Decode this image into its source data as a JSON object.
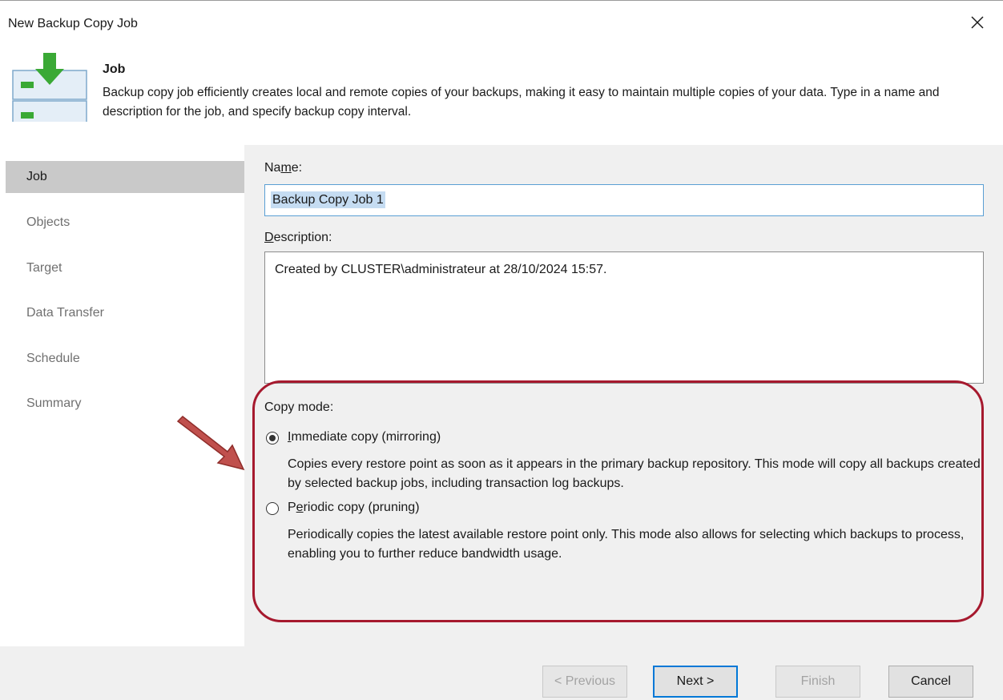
{
  "window": {
    "title": "New Backup Copy Job"
  },
  "header": {
    "title": "Job",
    "description": "Backup copy job efficiently creates local and remote copies of your backups, making it easy to maintain multiple copies of your data. Type in a name and description for the job, and specify backup copy interval."
  },
  "nav": {
    "items": [
      {
        "label": "Job",
        "active": true
      },
      {
        "label": "Objects",
        "active": false
      },
      {
        "label": "Target",
        "active": false
      },
      {
        "label": "Data Transfer",
        "active": false
      },
      {
        "label": "Schedule",
        "active": false
      },
      {
        "label": "Summary",
        "active": false
      }
    ]
  },
  "form": {
    "name_label": "Name:",
    "name_value": "Backup Copy Job 1",
    "description_label": "Description:",
    "description_value": "Created by CLUSTER\\administrateur at 28/10/2024 15:57.",
    "copy_mode_label": "Copy mode:",
    "options": [
      {
        "label": "Immediate copy (mirroring)",
        "selected": true,
        "description": "Copies every restore point as soon as it appears in the primary backup repository. This mode will copy all backups created by selected backup jobs, including transaction log backups."
      },
      {
        "label": "Periodic copy (pruning)",
        "selected": false,
        "description": "Periodically copies the latest available restore point only. This mode also allows for selecting which backups to process, enabling you to further reduce bandwidth usage."
      }
    ]
  },
  "footer": {
    "previous_label": "< Previous",
    "next_label": "Next >",
    "finish_label": "Finish",
    "cancel_label": "Cancel"
  },
  "colors": {
    "highlight": "#a6192e",
    "arrow": "#c0504d",
    "accent": "#0078d7",
    "icon_green": "#3aa935"
  }
}
